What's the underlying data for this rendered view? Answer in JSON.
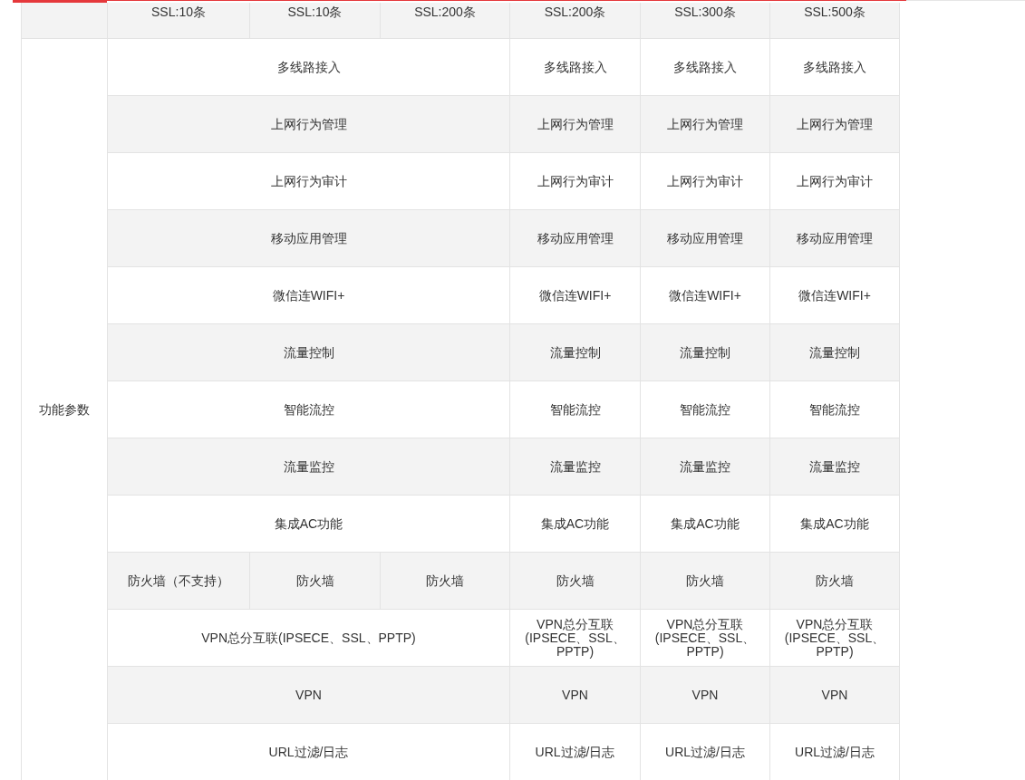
{
  "header_row": {
    "cells": [
      "SSL:10条",
      "SSL:10条",
      "SSL:200条",
      "SSL:200条",
      "SSL:300条",
      "SSL:500条"
    ]
  },
  "section": {
    "label": "功能参数",
    "rows": [
      {
        "kind": "merged",
        "shared": "多线路接入",
        "cells": [
          "多线路接入",
          "多线路接入",
          "多线路接入"
        ]
      },
      {
        "kind": "merged",
        "shared": "上网行为管理",
        "cells": [
          "上网行为管理",
          "上网行为管理",
          "上网行为管理"
        ]
      },
      {
        "kind": "merged",
        "shared": "上网行为审计",
        "cells": [
          "上网行为审计",
          "上网行为审计",
          "上网行为审计"
        ]
      },
      {
        "kind": "merged",
        "shared": "移动应用管理",
        "cells": [
          "移动应用管理",
          "移动应用管理",
          "移动应用管理"
        ]
      },
      {
        "kind": "merged",
        "shared": "微信连WIFI+",
        "cells": [
          "微信连WIFI+",
          "微信连WIFI+",
          "微信连WIFI+"
        ]
      },
      {
        "kind": "merged",
        "shared": "流量控制",
        "cells": [
          "流量控制",
          "流量控制",
          "流量控制"
        ]
      },
      {
        "kind": "merged",
        "shared": "智能流控",
        "cells": [
          "智能流控",
          "智能流控",
          "智能流控"
        ]
      },
      {
        "kind": "merged",
        "shared": "流量监控",
        "cells": [
          "流量监控",
          "流量监控",
          "流量监控"
        ]
      },
      {
        "kind": "merged",
        "shared": "集成AC功能",
        "cells": [
          "集成AC功能",
          "集成AC功能",
          "集成AC功能"
        ]
      },
      {
        "kind": "split",
        "cells": [
          "防火墙（不支持）",
          "防火墙",
          "防火墙",
          "防火墙",
          "防火墙",
          "防火墙"
        ]
      },
      {
        "kind": "merged",
        "shared": "VPN总分互联(IPSECE、SSL、PPTP)",
        "cells": [
          "VPN总分互联(IPSECE、SSL、PPTP)",
          "VPN总分互联(IPSECE、SSL、PPTP)",
          "VPN总分互联(IPSECE、SSL、PPTP)"
        ]
      },
      {
        "kind": "merged",
        "shared": "VPN",
        "cells": [
          "VPN",
          "VPN",
          "VPN"
        ]
      },
      {
        "kind": "merged",
        "shared": "URL过滤/日志",
        "cells": [
          "URL过滤/日志",
          "URL过滤/日志",
          "URL过滤/日志"
        ]
      }
    ]
  }
}
